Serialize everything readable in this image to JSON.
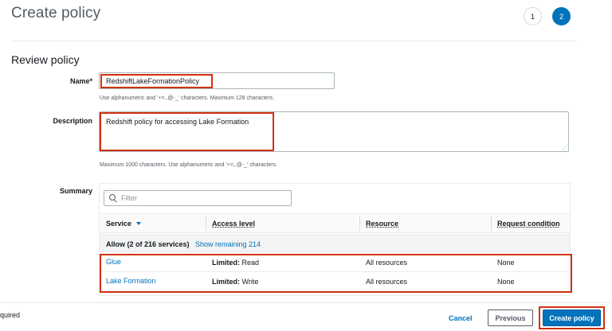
{
  "header": {
    "title": "Create policy",
    "steps": [
      "1",
      "2"
    ],
    "active_step": "2"
  },
  "review": {
    "section_title": "Review policy",
    "name_label": "Name*",
    "name_value": "RedshiftLakeFormationPolicy",
    "name_hint": "Use alphanumeric and '+=,.@-_' characters. Maximum 128 characters.",
    "description_label": "Description",
    "description_value": "Redshift policy for accessing Lake Formation",
    "description_hint": "Maximum 1000 characters. Use alphanumeric and '+=,.@-_' characters.",
    "summary_label": "Summary"
  },
  "summary": {
    "filter_placeholder": "Filter",
    "columns": [
      "Service",
      "Access level",
      "Resource",
      "Request condition"
    ],
    "allow_text": "Allow (2 of 216 services)",
    "show_remaining": "Show remaining 214",
    "rows": [
      {
        "service": "Glue",
        "access_prefix": "Limited:",
        "access_value": " Read",
        "resource": "All resources",
        "condition": "None"
      },
      {
        "service": "Lake Formation",
        "access_prefix": "Limited:",
        "access_value": " Write",
        "resource": "All resources",
        "condition": "None"
      }
    ]
  },
  "footer": {
    "required_note": "quired",
    "cancel_label": "Cancel",
    "previous_label": "Previous",
    "create_label": "Create policy"
  },
  "colors": {
    "accent": "#0073bb",
    "highlight": "#d13212"
  },
  "icons": [
    "search-icon",
    "sort-down-icon",
    "resize-grip-icon"
  ]
}
